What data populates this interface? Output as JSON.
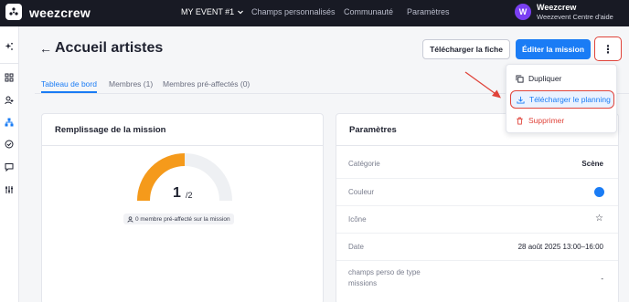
{
  "app": {
    "logo_text": "weezcrew"
  },
  "topnav": {
    "event_label": "MY EVENT #1",
    "links": [
      "Champs personnalisés",
      "Communauté",
      "Paramètres"
    ]
  },
  "user": {
    "initial": "W",
    "name": "Weezcrew",
    "org": "Weezevent Centre d'aide"
  },
  "page": {
    "back_icon": "arrow-left-icon",
    "title": "Accueil artistes"
  },
  "actions": {
    "download_sheet": "Télécharger la fiche",
    "edit_mission": "Éditer la mission",
    "more": "⋮"
  },
  "tabs": [
    {
      "label": "Tableau de bord",
      "active": true
    },
    {
      "label": "Membres (1)",
      "active": false
    },
    {
      "label": "Membres pré-affectés (0)",
      "active": false
    }
  ],
  "fill_card": {
    "title": "Remplissage de la mission",
    "filled": "1",
    "total": "/2",
    "fill_ratio": 0.5,
    "preassigned_note": "0 membre pré-affecté sur la mission"
  },
  "params_card": {
    "title": "Paramètres",
    "rows": [
      {
        "label": "Catégorie",
        "value": "Scène"
      },
      {
        "label": "Couleur",
        "value_color": "#1a7cf5"
      },
      {
        "label": "Icône",
        "value_icon": "star-icon"
      },
      {
        "label": "Date",
        "value": "28 août 2025 13:00–16:00"
      },
      {
        "label": "champs perso de type missions",
        "value": "-"
      }
    ]
  },
  "menu": {
    "items": [
      {
        "label": "Dupliquer",
        "icon": "copy-icon"
      },
      {
        "label": "Télécharger le planning",
        "icon": "download-icon"
      },
      {
        "label": "Supprimer",
        "icon": "trash-icon"
      }
    ]
  },
  "colors": {
    "accent": "#1a7cf5",
    "topbar": "#181a24",
    "gauge": "#f59a1b",
    "danger": "#e0433a",
    "avatar": "#7a3ff2"
  }
}
